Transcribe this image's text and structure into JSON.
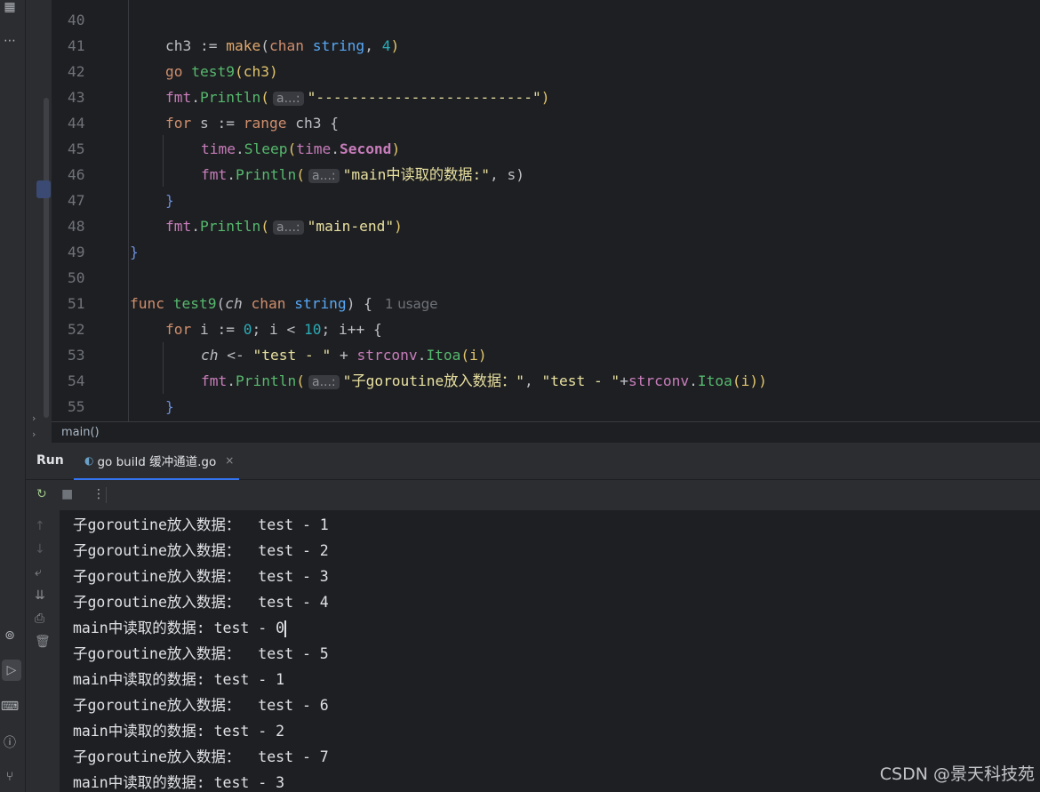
{
  "editor": {
    "lines": [
      {
        "n": "40"
      },
      {
        "n": "41",
        "t": [
          "ch3 := ",
          "make",
          "(",
          "chan",
          " ",
          "string",
          ", ",
          "4",
          ")"
        ]
      },
      {
        "n": "42",
        "t": [
          "go",
          " ",
          "test9",
          "(ch3)"
        ]
      },
      {
        "n": "43",
        "t": [
          "fmt",
          ".",
          "Println",
          "(",
          "a...:",
          "\"-------------------------\"",
          ")"
        ]
      },
      {
        "n": "44",
        "t": [
          "for",
          " s := ",
          "range",
          " ch3 {"
        ]
      },
      {
        "n": "45",
        "t": [
          "time",
          ".",
          "Sleep",
          "(",
          "time",
          ".",
          "Second",
          ")"
        ]
      },
      {
        "n": "46",
        "t": [
          "fmt",
          ".",
          "Println",
          "(",
          "a...:",
          "\"main中读取的数据:\"",
          ", s)"
        ]
      },
      {
        "n": "47",
        "t": [
          "}"
        ]
      },
      {
        "n": "48",
        "t": [
          "fmt",
          ".",
          "Println",
          "(",
          "a...:",
          "\"main-end\"",
          ")"
        ]
      },
      {
        "n": "49",
        "t": [
          "}"
        ]
      },
      {
        "n": "50"
      },
      {
        "n": "51",
        "t": [
          "func",
          " ",
          "test9",
          "(",
          "ch",
          " ",
          "chan",
          " ",
          "string",
          ") {",
          "1 usage"
        ]
      },
      {
        "n": "52",
        "t": [
          "for",
          " i := ",
          "0",
          "; i < ",
          "10",
          "; i++ {"
        ]
      },
      {
        "n": "53",
        "t": [
          "ch",
          " <- ",
          "\"test - \"",
          " + ",
          "strconv",
          ".",
          "Itoa",
          "(i)"
        ]
      },
      {
        "n": "54",
        "t": [
          "fmt",
          ".",
          "Println",
          "(",
          "a...:",
          "\"子goroutine放入数据：\"",
          ", ",
          "\"test - \"",
          "+",
          "strconv",
          ".",
          "Itoa",
          "(i))"
        ]
      },
      {
        "n": "55",
        "t": [
          "}"
        ]
      }
    ]
  },
  "breadcrumb": "main()",
  "run_panel": {
    "label": "Run",
    "tab": "go build 缓冲通道.go",
    "close": "×"
  },
  "console": [
    "子goroutine放入数据：  test - 1",
    "子goroutine放入数据：  test - 2",
    "子goroutine放入数据：  test - 3",
    "子goroutine放入数据：  test - 4",
    "main中读取的数据: test - 0",
    "子goroutine放入数据：  test - 5",
    "main中读取的数据: test - 1",
    "子goroutine放入数据：  test - 6",
    "main中读取的数据: test - 2",
    "子goroutine放入数据：  test - 7",
    "main中读取的数据: test - 3"
  ],
  "watermark": "CSDN @景天科技苑",
  "colors": {
    "keyword": "#cf8e6d",
    "string": "#6aab73",
    "function": "#56a8f5",
    "number": "#2aacb8",
    "package": "#c77dbb",
    "accent": "#3574f0"
  }
}
